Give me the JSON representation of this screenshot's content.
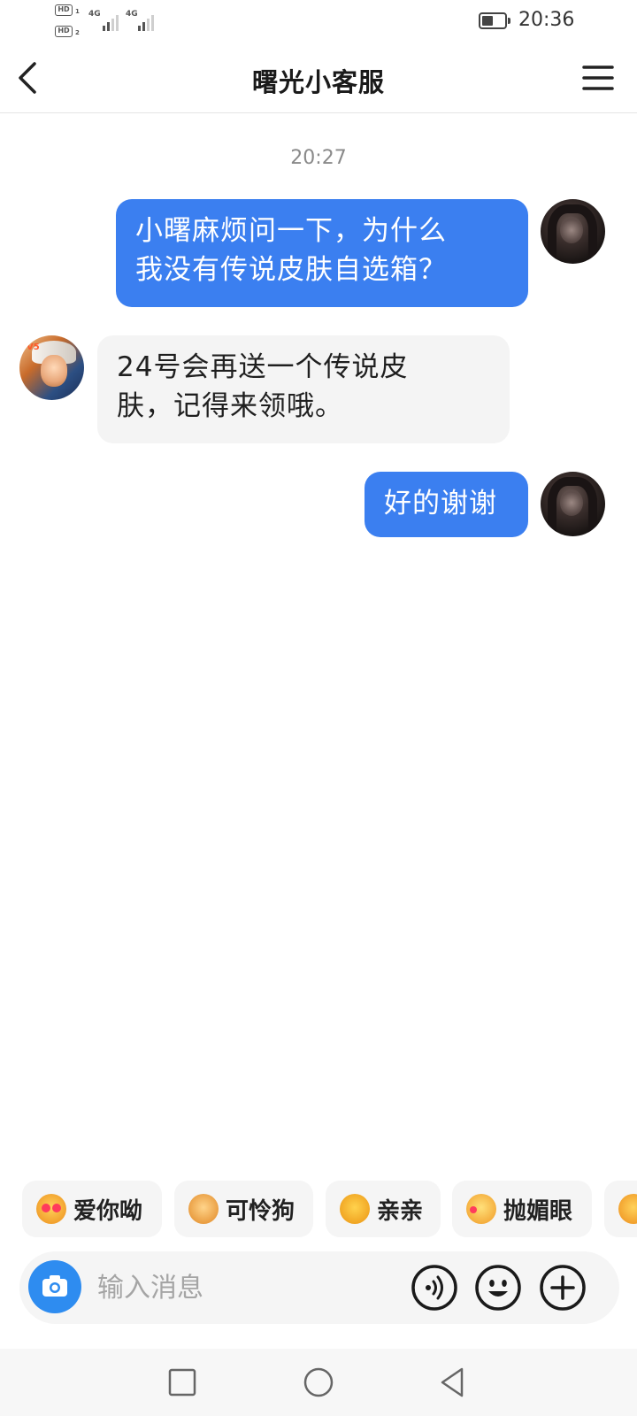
{
  "status_bar": {
    "sim1_label": "HD",
    "sim1_slot": "1",
    "sim2_label": "HD",
    "sim2_slot": "2",
    "network1": "4G",
    "network2": "4G",
    "time": "20:36",
    "battery_level": 0.5,
    "icons": [
      "hd-icon",
      "signal-icon",
      "battery-icon"
    ]
  },
  "header": {
    "title": "曙光小客服",
    "back_icon": "chevron-left-icon",
    "menu_icon": "hamburger-menu-icon"
  },
  "chat": {
    "timestamp": "20:27",
    "messages": [
      {
        "sender": "user",
        "text": "小曙麻烦问一下，为什么\n我没有传说皮肤自选箱？"
      },
      {
        "sender": "agent",
        "text": "24号会再送一个传说皮\n肤，记得来领哦。"
      },
      {
        "sender": "user",
        "text": "好的谢谢"
      }
    ]
  },
  "quick_replies": [
    {
      "label": "爱你呦",
      "icon": "heart-eyes-emoji-icon"
    },
    {
      "label": "可怜狗",
      "icon": "puppy-emoji-icon"
    },
    {
      "label": "亲亲",
      "icon": "hug-emoji-icon"
    },
    {
      "label": "抛媚眼",
      "icon": "wink-emoji-icon"
    }
  ],
  "input_bar": {
    "placeholder": "输入消息",
    "icons": [
      "camera-icon",
      "voice-icon",
      "smiley-icon",
      "plus-icon"
    ]
  },
  "colors": {
    "outgoing_bubble": "#3b7ff0",
    "incoming_bubble": "#f4f4f4",
    "camera_button": "#2e8cf0"
  },
  "nav_bar": {
    "icons": [
      "recent-apps-icon",
      "home-icon",
      "back-icon"
    ]
  }
}
